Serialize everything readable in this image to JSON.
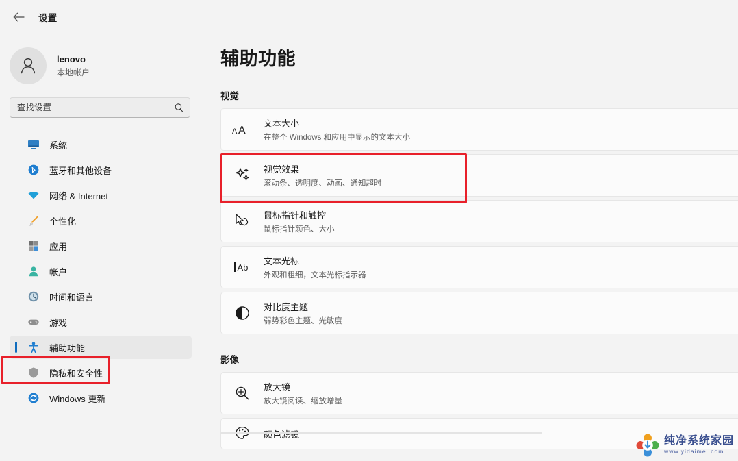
{
  "window": {
    "title": "设置",
    "back_label": "返回"
  },
  "account": {
    "name": "lenovo",
    "type": "本地帐户"
  },
  "search": {
    "placeholder": "查找设置",
    "value": ""
  },
  "sidebar": {
    "items": [
      {
        "label": "系统",
        "icon": "monitor-icon",
        "selected": false
      },
      {
        "label": "蓝牙和其他设备",
        "icon": "bluetooth-icon",
        "selected": false
      },
      {
        "label": "网络 & Internet",
        "icon": "wifi-icon",
        "selected": false
      },
      {
        "label": "个性化",
        "icon": "brush-icon",
        "selected": false
      },
      {
        "label": "应用",
        "icon": "apps-icon",
        "selected": false
      },
      {
        "label": "帐户",
        "icon": "person-icon",
        "selected": false
      },
      {
        "label": "时间和语言",
        "icon": "clock-globe-icon",
        "selected": false
      },
      {
        "label": "游戏",
        "icon": "gamepad-icon",
        "selected": false
      },
      {
        "label": "辅助功能",
        "icon": "accessibility-icon",
        "selected": true
      },
      {
        "label": "隐私和安全性",
        "icon": "shield-icon",
        "selected": false
      },
      {
        "label": "Windows 更新",
        "icon": "update-icon",
        "selected": false
      }
    ]
  },
  "main": {
    "page_title": "辅助功能",
    "sections": [
      {
        "heading": "视觉",
        "cards": [
          {
            "title": "文本大小",
            "subtitle": "在整个 Windows 和应用中显示的文本大小",
            "icon": "text-size-icon",
            "highlighted": false
          },
          {
            "title": "视觉效果",
            "subtitle": "滚动条、透明度、动画、通知超时",
            "icon": "sparkle-icon",
            "highlighted": true
          },
          {
            "title": "鼠标指针和触控",
            "subtitle": "鼠标指针颜色、大小",
            "icon": "mouse-pointer-icon",
            "highlighted": false
          },
          {
            "title": "文本光标",
            "subtitle": "外观和粗细，文本光标指示器",
            "icon": "text-cursor-icon",
            "highlighted": false
          },
          {
            "title": "对比度主题",
            "subtitle": "弱势彩色主题、光敏度",
            "icon": "contrast-icon",
            "highlighted": false
          }
        ]
      },
      {
        "heading": "影像",
        "cards": [
          {
            "title": "放大镜",
            "subtitle": "放大镜阅读、缩放增量",
            "icon": "magnifier-icon",
            "highlighted": false
          },
          {
            "title": "颜色滤镜",
            "subtitle": "",
            "icon": "color-filter-icon",
            "highlighted": false
          }
        ]
      }
    ]
  },
  "annotations": {
    "sidebar_highlight_target": "辅助功能",
    "card_highlight_target": "视觉效果",
    "box_color": "#e8202a"
  },
  "watermark": {
    "brand": "纯净系统家园",
    "url": "www.yidaimei.com"
  },
  "colors": {
    "page_background": "#f3f3f3",
    "card_background": "#fbfbfb",
    "accent": "#0f6cbd",
    "selected_nav_background": "#e8e8e8",
    "annotation_red": "#e8202a"
  }
}
